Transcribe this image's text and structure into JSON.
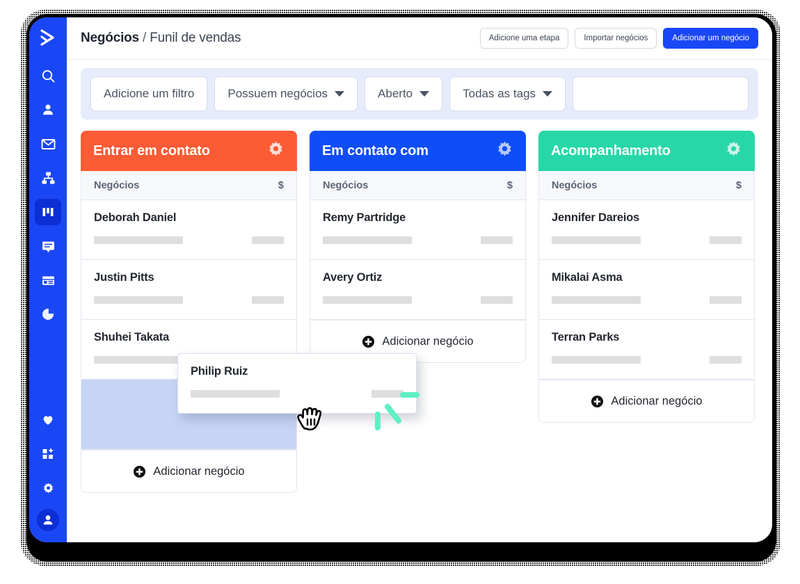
{
  "header": {
    "breadcrumb_primary": "Negócios",
    "breadcrumb_separator": "/",
    "breadcrumb_secondary": "Funil de vendas",
    "buttons": [
      {
        "label": "Adicione uma etapa",
        "style": "secondary"
      },
      {
        "label": "Importar negócios",
        "style": "secondary"
      },
      {
        "label": "Adicionar um negócio",
        "style": "primary"
      }
    ]
  },
  "filters": {
    "add_filter_label": "Adicione um filtro",
    "has_deals_label": "Possuem negócios",
    "status_label": "Aberto",
    "tags_label": "Todas as tags",
    "search_placeholder": "",
    "search_value": "",
    "search_icon": "search-icon"
  },
  "board": {
    "deals_column_label": "Negócios",
    "money_column_label": "$",
    "add_deal_label": "Adicionar negócio",
    "gear_icon": "gear-icon",
    "plus_icon": "plus-circle-icon",
    "columns": [
      {
        "title": "Entrar em contato",
        "color": "#fb5b35",
        "cards": [
          {
            "name": "Deborah Daniel"
          },
          {
            "name": "Justin Pitts"
          },
          {
            "name": "Shuhei Takata"
          }
        ],
        "has_dropzone": true
      },
      {
        "title": "Em contato com",
        "color": "#0f4ef7",
        "cards": [
          {
            "name": "Remy Partridge"
          },
          {
            "name": "Avery Ortiz"
          }
        ],
        "has_dropzone": false
      },
      {
        "title": "Acompanhamento",
        "color": "#27d7a7",
        "cards": [
          {
            "name": "Jennifer Dareios"
          },
          {
            "name": "Mikalai Asma"
          },
          {
            "name": "Terran Parks"
          }
        ],
        "has_dropzone": false
      }
    ]
  },
  "drag": {
    "card_name": "Philip Ruiz",
    "cursor_icon": "grabbing-hand-cursor",
    "motion_color": "#5ef0c2"
  },
  "sidebar": {
    "brand_icon": "activecampaign-logo-icon",
    "items": [
      {
        "icon": "search-icon",
        "name": "sidebar-item-search",
        "active": false
      },
      {
        "icon": "contact-person-icon",
        "name": "sidebar-item-contacts",
        "active": false
      },
      {
        "icon": "mail-icon",
        "name": "sidebar-item-campaigns",
        "active": false
      },
      {
        "icon": "automation-flow-icon",
        "name": "sidebar-item-automations",
        "active": false
      },
      {
        "icon": "kanban-board-icon",
        "name": "sidebar-item-deals",
        "active": true
      },
      {
        "icon": "chat-bubble-icon",
        "name": "sidebar-item-conversations",
        "active": false
      },
      {
        "icon": "website-window-icon",
        "name": "sidebar-item-website",
        "active": false
      },
      {
        "icon": "pie-chart-icon",
        "name": "sidebar-item-reports",
        "active": false
      }
    ],
    "bottom_items": [
      {
        "icon": "heart-icon",
        "name": "sidebar-item-favorites"
      },
      {
        "icon": "apps-grid-plus-icon",
        "name": "sidebar-item-apps"
      },
      {
        "icon": "gear-icon",
        "name": "sidebar-item-settings"
      },
      {
        "icon": "user-avatar-icon",
        "name": "sidebar-item-account"
      }
    ]
  },
  "colors": {
    "brand_blue": "#1a47f5",
    "active_blue": "#0b2fd4",
    "column_orange": "#fb5b35",
    "column_blue": "#0f4ef7",
    "column_teal": "#27d7a7",
    "dropzone_blue": "#c6d5f5",
    "filter_bar_bg": "#e6ecfb"
  }
}
